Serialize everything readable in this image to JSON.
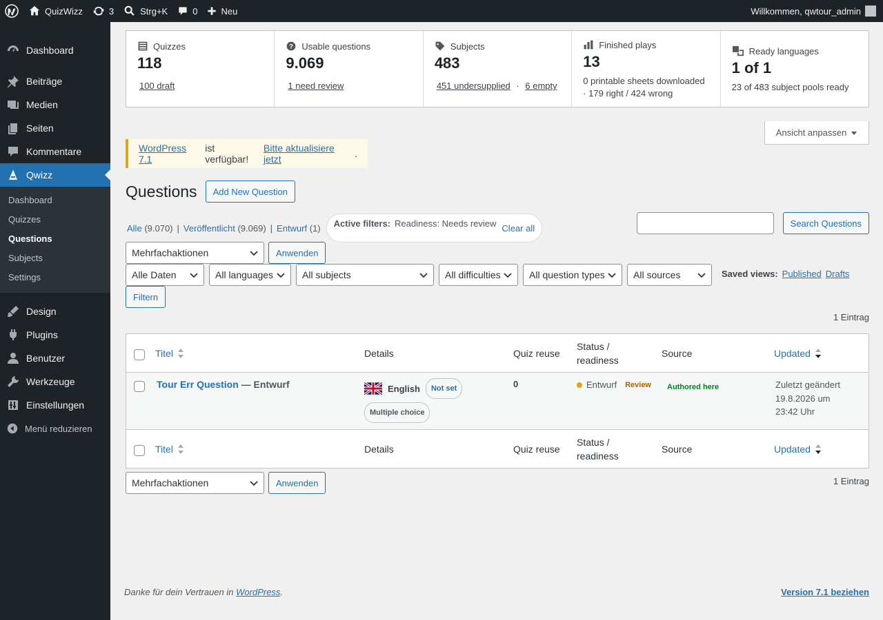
{
  "adminbar": {
    "site": "QuizWizz",
    "updates": "3",
    "shortcut": "Strg+K",
    "comments": "0",
    "new": "Neu",
    "welcome": "Willkommen, qwtour_admin"
  },
  "menu": {
    "items": [
      "Dashboard",
      "Beiträge",
      "Medien",
      "Seiten",
      "Kommentare",
      "Qwizz",
      "Design",
      "Plugins",
      "Benutzer",
      "Werkzeuge",
      "Einstellungen",
      "Menü reduzieren"
    ],
    "submenu": [
      "Dashboard",
      "Quizzes",
      "Questions",
      "Subjects",
      "Settings"
    ]
  },
  "stats": {
    "quizzes": {
      "label": "Quizzes",
      "value": "118",
      "link": "100 draft"
    },
    "questions": {
      "label": "Usable questions",
      "value": "9.069",
      "link": "1 need review"
    },
    "subjects": {
      "label": "Subjects",
      "value": "483",
      "link1": "451 undersupplied",
      "sep": "·",
      "link2": "6 empty"
    },
    "plays": {
      "label": "Finished plays",
      "value": "13",
      "line1": "0 printable sheets downloaded",
      "line2": "· 179 right / 424 wrong"
    },
    "languages": {
      "label": "Ready languages",
      "value": "1 of 1",
      "line1": "23 of 483 subject pools ready"
    }
  },
  "screen_options": "Ansicht anpassen",
  "notice": {
    "link1": "WordPress 7.1",
    "text": "ist verfügbar!",
    "link2": "Bitte aktualisiere jetzt",
    "end": "."
  },
  "page": {
    "title": "Questions",
    "add_new": "Add New Question"
  },
  "subsubsub": {
    "all": "Alle",
    "all_count": "(9.070)",
    "published": "Veröffentlicht",
    "published_count": "(9.069)",
    "draft": "Entwurf",
    "draft_count": "(1)",
    "sep": "|"
  },
  "active_filters": {
    "label": "Active filters:",
    "value": "Readiness: Needs review",
    "clear": "Clear all"
  },
  "search": {
    "button": "Search Questions",
    "value": ""
  },
  "bulk": {
    "select": "Mehrfachaktionen",
    "apply": "Anwenden"
  },
  "filters": {
    "dates": "Alle Daten",
    "languages": "All languages",
    "subjects": "All subjects",
    "difficulties": "All difficulties",
    "types": "All question types",
    "sources": "All sources",
    "saved_label": "Saved views:",
    "saved1": "Published",
    "saved2": "Drafts",
    "filter_btn": "Filtern"
  },
  "count": "1 Eintrag",
  "table": {
    "headers": {
      "title": "Titel",
      "details": "Details",
      "reuse": "Quiz reuse",
      "status1": "Status /",
      "status2": "readiness",
      "source": "Source",
      "updated": "Updated"
    },
    "rows": [
      {
        "title": "Tour Err Question",
        "state": "— Entwurf",
        "language": "English",
        "lang_badge": "Not set",
        "type": "Multiple choice",
        "reuse": "0",
        "status": "Entwurf",
        "readiness": "Review",
        "source": "Authored here",
        "updated1": "Zuletzt geändert",
        "updated2": "19.8.2026 um",
        "updated3": "23:42 Uhr"
      }
    ]
  },
  "footer": {
    "text": "Danke für dein Vertrauen in",
    "link": "WordPress",
    "end": ".",
    "version": "Version 7.1 beziehen"
  },
  "colors": {
    "accent": "#2271b1",
    "sidebar": "#1d2327",
    "notice": "#dba617",
    "status_dot": "#dba617",
    "authored": "#00a32a"
  }
}
